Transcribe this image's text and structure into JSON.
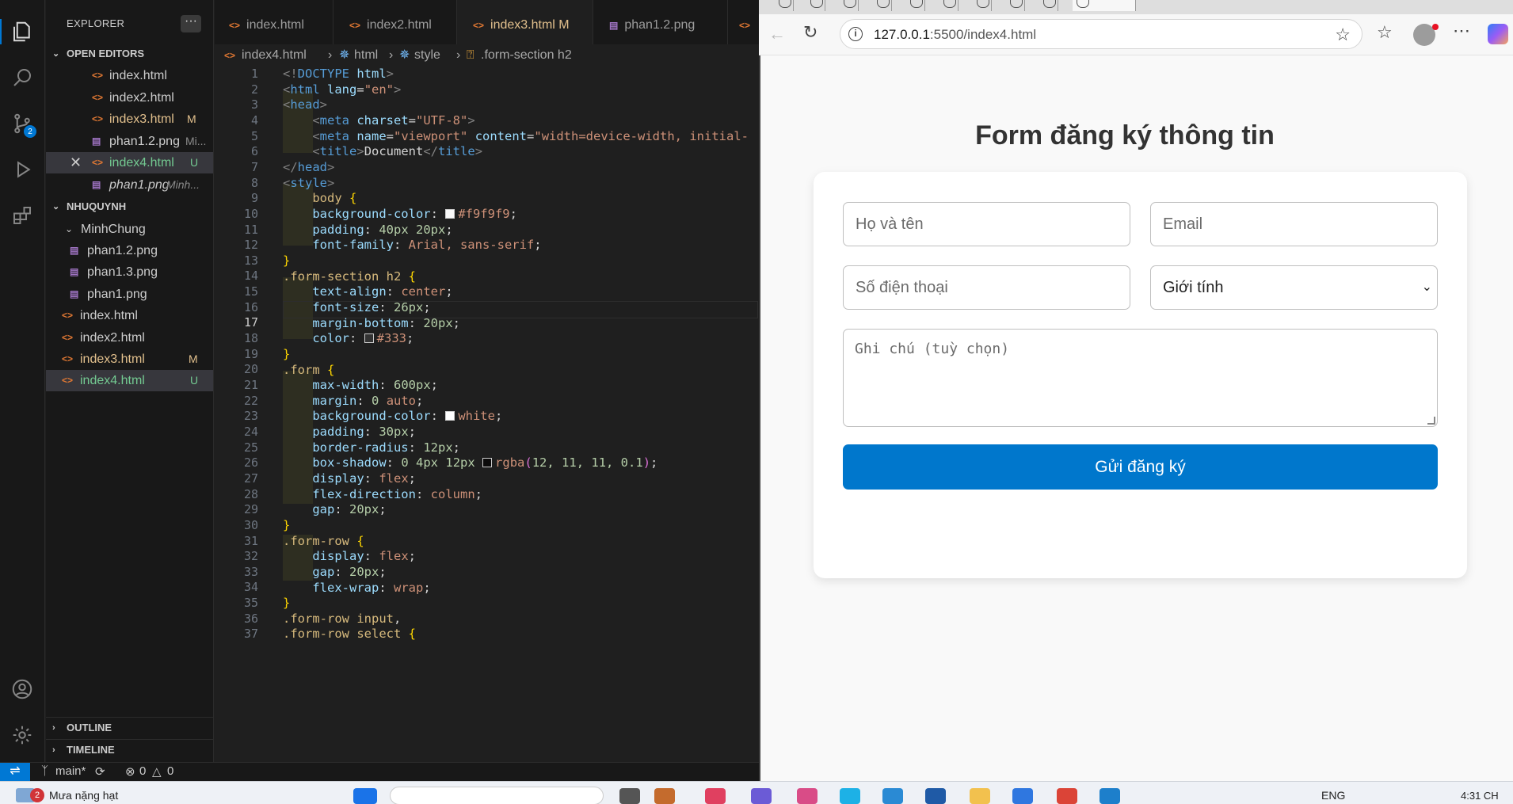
{
  "sidebar": {
    "title": "EXPLORER",
    "more": "···",
    "open_editors_label": "OPEN EDITORS",
    "open_editors": [
      {
        "name": "index.html",
        "status": "",
        "kind": "html"
      },
      {
        "name": "index2.html",
        "status": "",
        "kind": "html"
      },
      {
        "name": "index3.html",
        "status": "M",
        "kind": "html"
      },
      {
        "name": "phan1.2.png",
        "status": "Mi...",
        "kind": "img"
      },
      {
        "name": "index4.html",
        "status": "U",
        "kind": "html"
      },
      {
        "name": "phan1.png",
        "status": "Minh...",
        "kind": "img"
      }
    ],
    "folder_label": "NHUQUYNH",
    "subfolder": "MinhChung",
    "sub_files": [
      "phan1.2.png",
      "phan1.3.png",
      "phan1.png"
    ],
    "files": [
      {
        "name": "index.html",
        "status": ""
      },
      {
        "name": "index2.html",
        "status": ""
      },
      {
        "name": "index3.html",
        "status": "M"
      },
      {
        "name": "index4.html",
        "status": "U"
      }
    ],
    "outline_label": "OUTLINE",
    "timeline_label": "TIMELINE"
  },
  "activity": {
    "scm_badge": "2"
  },
  "tabs": [
    {
      "name": "index.html",
      "status": ""
    },
    {
      "name": "index2.html",
      "status": ""
    },
    {
      "name": "index3.html",
      "status": "M"
    },
    {
      "name": "phan1.2.png",
      "status": ""
    }
  ],
  "breadcrumb": [
    "index4.html",
    "html",
    "style",
    ".form-section h2"
  ],
  "editor": {
    "current_line": "17",
    "line_numbers": [
      "1",
      "2",
      "3",
      "4",
      "5",
      "6",
      "7",
      "8",
      "9",
      "10",
      "11",
      "12",
      "13",
      "14",
      "15",
      "16",
      "17",
      "18",
      "19",
      "20",
      "21",
      "22",
      "23",
      "24",
      "25",
      "26",
      "27",
      "28",
      "29",
      "30",
      "31",
      "32",
      "33",
      "34",
      "35",
      "36",
      "37"
    ]
  },
  "status_bar": {
    "branch": "main*",
    "problems": "0",
    "warnings": "0"
  },
  "browser": {
    "url_host": "127.0.0.1",
    "url_path": ":5500/index4.html"
  },
  "form": {
    "title": "Form đăng ký thông tin",
    "name_placeholder": "Họ và tên",
    "email_placeholder": "Email",
    "phone_placeholder": "Số điện thoại",
    "gender_selected": "Giới tính",
    "note_placeholder": "Ghi chú (tuỳ chọn)",
    "submit_label": "Gửi đăng ký"
  },
  "taskbar": {
    "weather_badge": "2",
    "weather_text": "Mưa nặng hạt",
    "lang": "ENG",
    "time": "4:31 CH"
  }
}
